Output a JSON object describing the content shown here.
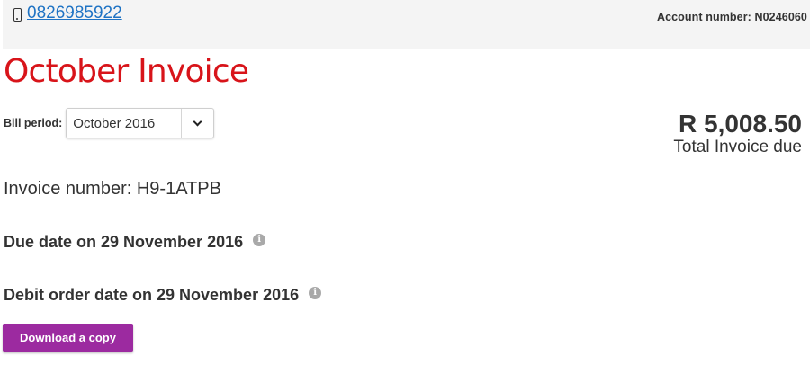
{
  "header": {
    "phone_icon": "mobile-phone-icon",
    "phone_number": "0826985922",
    "account_number": "Account number: N0246060"
  },
  "page_title": "October Invoice",
  "bill_period": {
    "label": "Bill period:",
    "selected": "October 2016",
    "dropdown_icon": "chevron-down-icon"
  },
  "total": {
    "amount": "R 5,008.50",
    "label": "Total Invoice due"
  },
  "invoice_number": "Invoice number: H9-1ATPB",
  "due_date": {
    "text": "Due date on 29 November 2016",
    "info_icon": "info-icon"
  },
  "debit_order_date": {
    "text": "Debit order date on 29 November 2016",
    "info_icon": "info-icon"
  },
  "download_button": "Download a copy",
  "colors": {
    "title_red": "#d8141a",
    "link_blue": "#1f73c4",
    "button_purple": "#9c2aa0",
    "header_bg": "#f4f4f4"
  }
}
